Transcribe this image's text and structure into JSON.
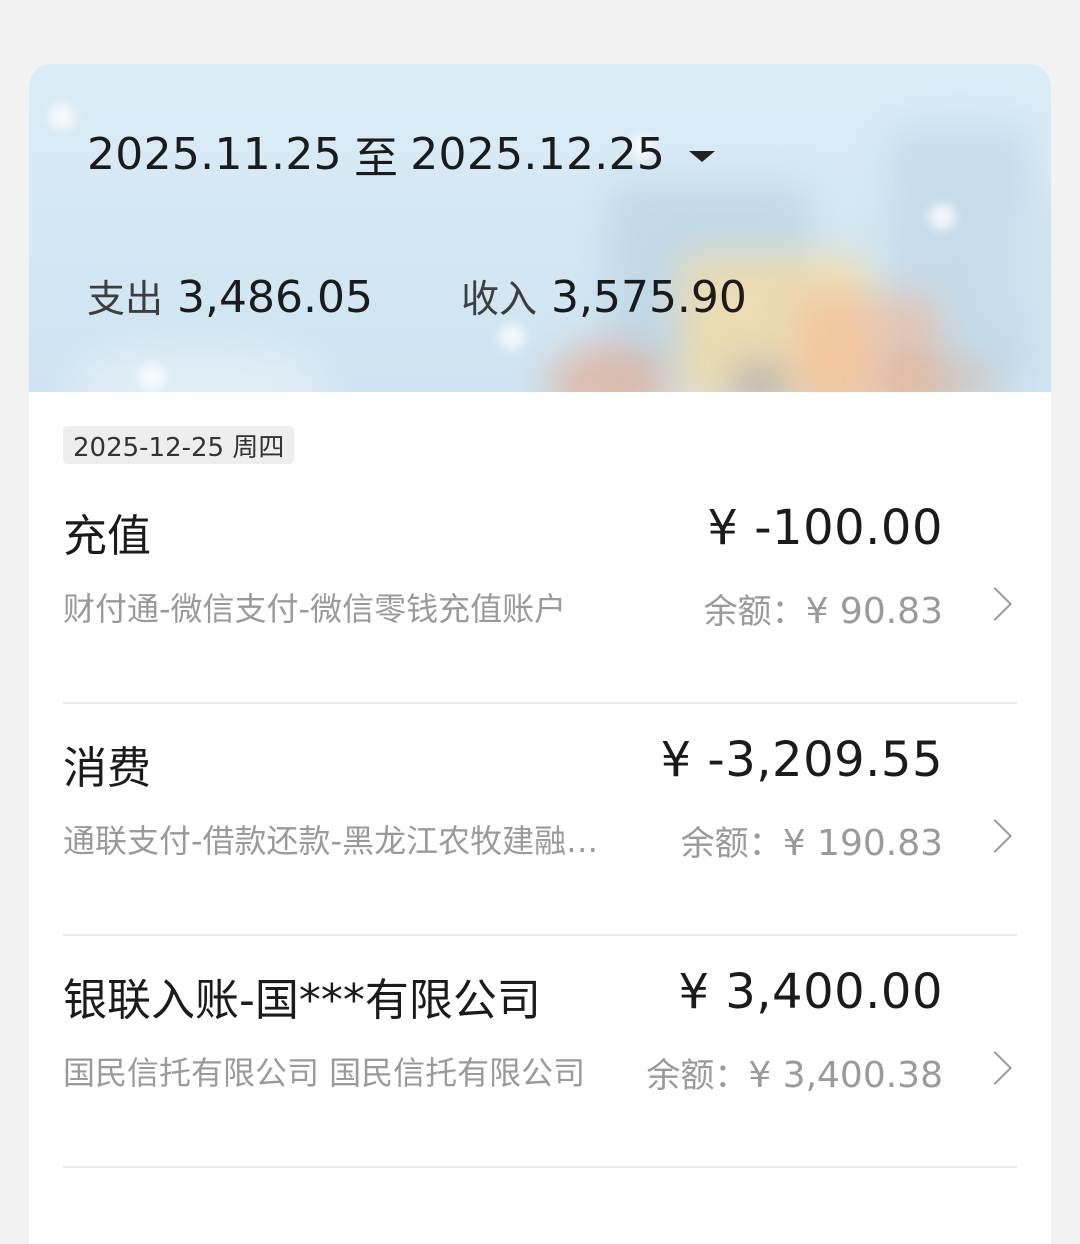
{
  "header": {
    "date_start": "2025.11.25",
    "date_sep": "至",
    "date_end": "2025.12.25",
    "expense_label": "支出",
    "expense_value": "3,486.05",
    "income_label": "收入",
    "income_value": "3,575.90"
  },
  "date_group": {
    "label": "2025-12-25 周四"
  },
  "transactions": [
    {
      "title": "充值",
      "amount": "¥ -100.00",
      "subtitle": "财付通-微信支付-微信零钱充值账户",
      "balance_label": "余额：",
      "balance_value": "¥ 90.83"
    },
    {
      "title": "消费",
      "amount": "¥ -3,209.55",
      "subtitle": "通联支付-借款还款-黑龙江农牧建融…",
      "balance_label": "余额：",
      "balance_value": "¥ 190.83"
    },
    {
      "title": "银联入账-国***有限公司",
      "amount": "¥ 3,400.00",
      "subtitle": "国民信托有限公司 国民信托有限公司",
      "balance_label": "余额：",
      "balance_value": "¥ 3,400.38"
    }
  ],
  "icons": {
    "dropdown": "caret-down-icon",
    "row_arrow": "chevron-right-icon"
  },
  "colors": {
    "page_bg": "#f2f2f2",
    "header_bg": "#d6e9f5",
    "text_primary": "#1b1b1b",
    "text_secondary": "#9a9a9a"
  }
}
